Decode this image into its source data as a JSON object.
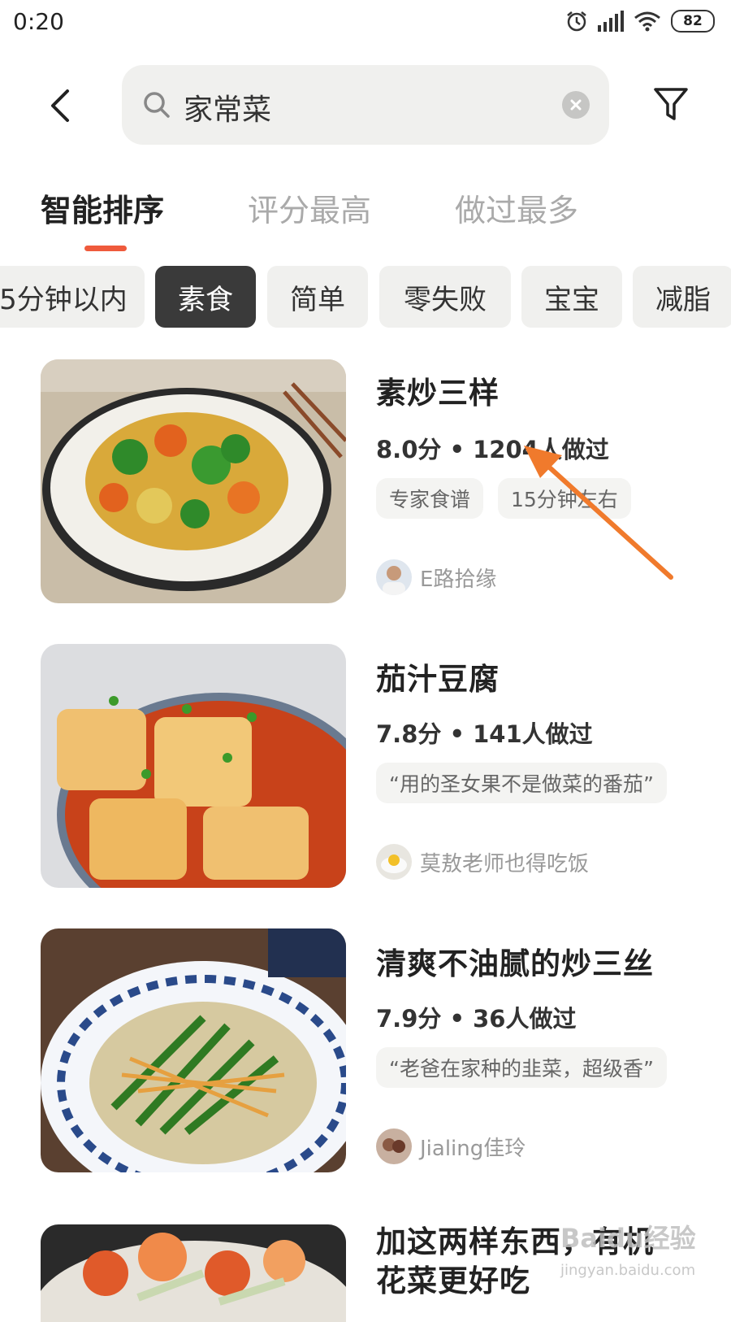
{
  "status_bar": {
    "time": "0:20",
    "battery": "82"
  },
  "search": {
    "query": "家常菜"
  },
  "tabs": [
    {
      "label": "智能排序",
      "active": true
    },
    {
      "label": "评分最高",
      "active": false
    },
    {
      "label": "做过最多",
      "active": false
    }
  ],
  "chips": [
    {
      "label": "5分钟以内",
      "selected": false
    },
    {
      "label": "素食",
      "selected": true
    },
    {
      "label": "简单",
      "selected": false
    },
    {
      "label": "零失败",
      "selected": false
    },
    {
      "label": "宝宝",
      "selected": false
    },
    {
      "label": "减脂",
      "selected": false
    }
  ],
  "recipes": [
    {
      "title": "素炒三样",
      "meta": "8.0分 • 1204人做过",
      "tags": [
        "专家食谱",
        "15分钟左右"
      ],
      "author": "E路拾缘"
    },
    {
      "title": "茄汁豆腐",
      "meta": "7.8分 • 141人做过",
      "tags": [
        "“用的圣女果不是做菜的番茄”"
      ],
      "author": "莫敖老师也得吃饭"
    },
    {
      "title": "清爽不油腻的炒三丝",
      "meta": "7.9分 • 36人做过",
      "tags": [
        "“老爸在家种的韭菜，超级香”"
      ],
      "author": "Jialing佳玲"
    },
    {
      "title_line1": "加这两样东西，有机",
      "title_line2": "花菜更好吃"
    }
  ],
  "colors": {
    "accent": "#ef5a3c",
    "arrow": "#f07a2c",
    "chip_selected": "#3a3a3a"
  },
  "watermark": {
    "main": "Baidu经验",
    "sub": "jingyan.baidu.com"
  }
}
